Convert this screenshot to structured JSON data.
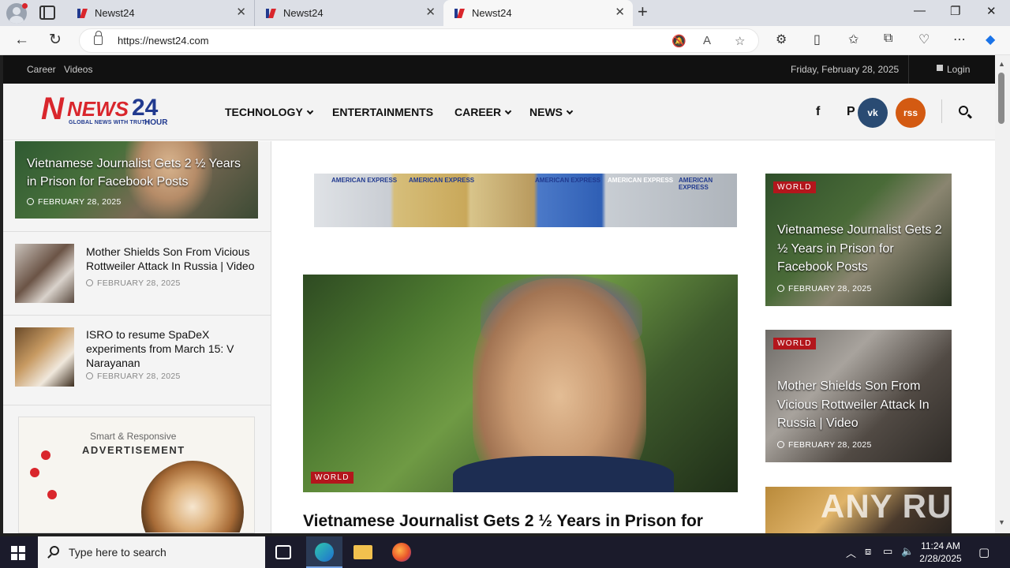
{
  "browser": {
    "tabs": [
      {
        "label": "Newst24"
      },
      {
        "label": "Newst24"
      },
      {
        "label": "Newst24"
      }
    ],
    "url": "https://newst24.com"
  },
  "site": {
    "topbar": {
      "links": [
        "Career",
        "Videos"
      ],
      "date": "Friday, February 28, 2025",
      "login": "Login"
    },
    "logo": {
      "word": "NEWS",
      "number": "24",
      "tagline": "GLOBAL NEWS WITH TRUTH",
      "hour": "HOUR"
    },
    "menu": [
      {
        "label": "TECHNOLOGY",
        "dropdown": true
      },
      {
        "label": "ENTERTAINMENTS",
        "dropdown": false
      },
      {
        "label": "CAREER",
        "dropdown": true
      },
      {
        "label": "NEWS",
        "dropdown": true
      }
    ],
    "social": {
      "facebook": "f",
      "pinterest": "P",
      "vk": "vk",
      "rss": "rss"
    }
  },
  "left": {
    "hero": {
      "title": "Vietnamese Journalist Gets 2 ½ Years in Prison for Facebook Posts",
      "date": "FEBRUARY 28, 2025"
    },
    "list": [
      {
        "title": "Mother Shields Son From Vicious Rottweiler Attack In Russia | Video",
        "date": "FEBRUARY 28, 2025"
      },
      {
        "title": "ISRO to resume SpaDeX experiments from March 15: V Narayanan",
        "date": "FEBRUARY 28, 2025"
      }
    ],
    "ad": {
      "small": "Smart & Responsive",
      "big": "ADVERTISEMENT"
    }
  },
  "center": {
    "banner_cards": [
      "AMERICAN EXPRESS",
      "AMERICAN EXPRESS",
      "AMERICAN EXPRESS",
      "AMERICAN EXPRESS",
      "AMERICAN EXPRESS"
    ],
    "main": {
      "badge": "WORLD",
      "title": "Vietnamese Journalist Gets 2 ½ Years in Prison for"
    }
  },
  "right": [
    {
      "badge": "WORLD",
      "title": "Vietnamese Journalist Gets 2 ½ Years in Prison for Facebook Posts",
      "date": "FEBRUARY 28, 2025"
    },
    {
      "badge": "WORLD",
      "title": "Mother Shields Son From Vicious Rottweiler Attack In Russia | Video",
      "date": "FEBRUARY 28, 2025"
    }
  ],
  "watermark": "ANY RUN",
  "taskbar": {
    "search_placeholder": "Type here to search",
    "time": "11:24 AM",
    "date": "2/28/2025"
  },
  "colors": {
    "accent_red": "#b3161c",
    "brand_blue": "#213a8f",
    "topbar": "#111111",
    "vk": "#2a4b73",
    "rss": "#d35a12"
  }
}
